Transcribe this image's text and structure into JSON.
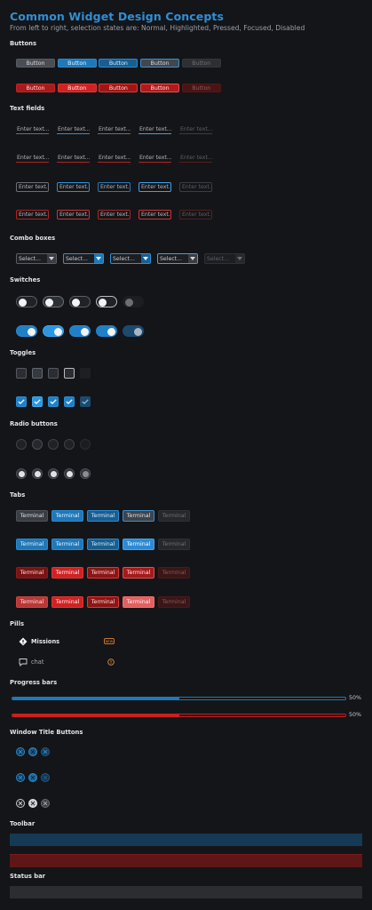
{
  "header": {
    "title": "Common Widget Design Concepts",
    "subtitle": "From left to right, selection states are: Normal, Highlighted, Pressed, Focused, Disabled"
  },
  "sections": {
    "buttons": "Buttons",
    "text_fields": "Text fields",
    "combo_boxes": "Combo boxes",
    "switches": "Switches",
    "toggles": "Toggles",
    "radio_buttons": "Radio buttons",
    "tabs": "Tabs",
    "pills": "Pills",
    "progress_bars": "Progress bars",
    "window_title_buttons": "Window Title Buttons",
    "toolbar": "Toolbar",
    "status_bar": "Status bar"
  },
  "button_label": "Button",
  "text_field_placeholder": "Enter text...",
  "combo_placeholder": "Select...",
  "tab_label": "Terminal",
  "pills": {
    "missions": "Missions",
    "missions_badge": "NEW",
    "chat": "chat"
  },
  "progress": [
    {
      "label": "50%",
      "value": 0.5,
      "color": "#1f78b8"
    },
    {
      "label": "50%",
      "value": 0.5,
      "color": "#c82020"
    }
  ],
  "colors": {
    "accent_blue": "#2e8fd6",
    "accent_red": "#c82020",
    "background": "#141518",
    "toolbar_blue": "#163a55",
    "toolbar_red": "#5e1616",
    "status_bar": "#2b2d31"
  },
  "icons": {
    "missions": "diamond-icon",
    "chat": "chat-bubble-icon",
    "chat_alert": "alert-circle-icon",
    "window_close": "close-circle-icon",
    "combo_arrow": "chevron-down-icon",
    "checkmark": "check-icon"
  }
}
